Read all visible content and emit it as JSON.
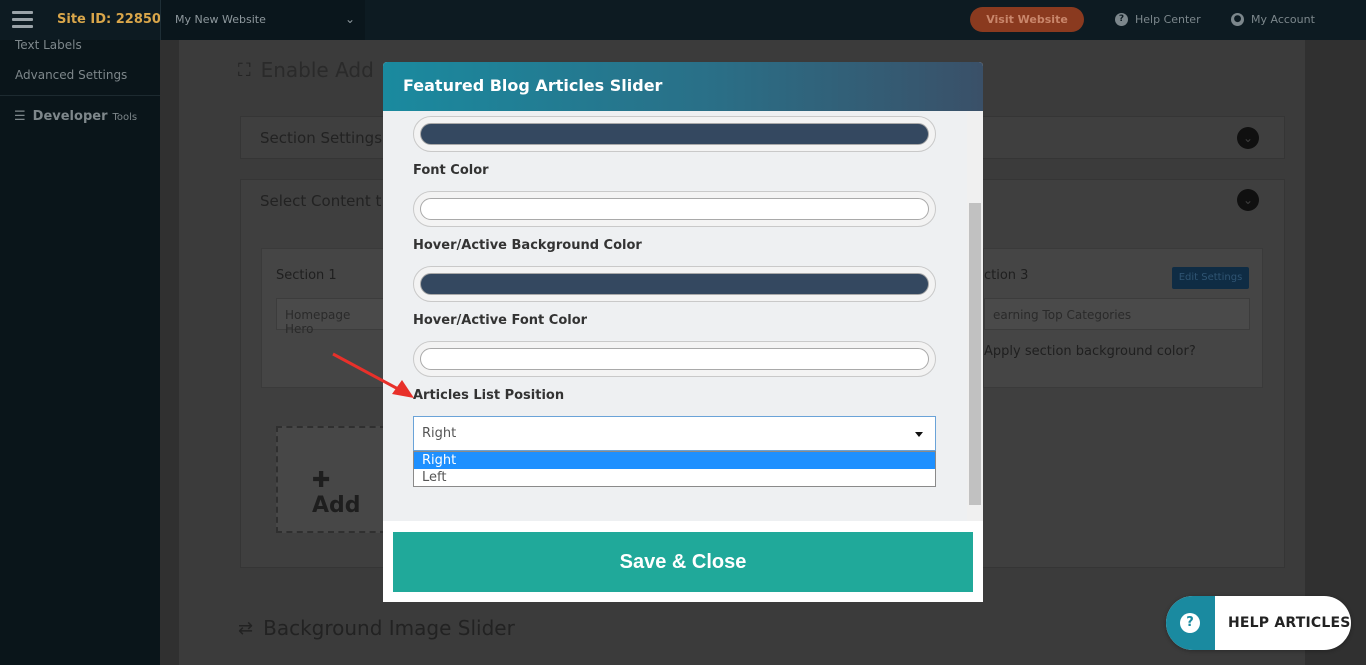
{
  "topbar": {
    "site_id": "Site ID: 22850",
    "site_select_value": "My New Website",
    "visit_button": "Visit Website",
    "help_center": "Help Center",
    "my_account": "My Account"
  },
  "sidebar": {
    "items": [
      {
        "label": "Text Labels"
      },
      {
        "label": "Advanced Settings"
      }
    ],
    "developer_tools": "Developer",
    "developer_tools_small": "Tools"
  },
  "background": {
    "heading1": "Enable Add",
    "panel1_title": "Section Settings",
    "panel2_title": "Select Content t",
    "section1_label": "Section 1",
    "section1_value": "Homepage Hero",
    "section3_label": "ction 3",
    "edit_settings": "Edit Settings",
    "section3_value": "earning Top Categories",
    "apply_bg": "Apply section background color?",
    "add_label": "Add",
    "heading2": "Background Image Slider"
  },
  "modal": {
    "title": "Featured Blog Articles Slider",
    "fields": [
      {
        "label": "Font Color"
      },
      {
        "label": "Hover/Active Background Color"
      },
      {
        "label": "Hover/Active Font Color"
      }
    ],
    "colors": {
      "top_swatch": "#344860",
      "font_color": "#ffffff",
      "hover_bg": "#344860",
      "hover_font": "#ffffff"
    },
    "position_label": "Articles List Position",
    "position_value": "Right",
    "options": [
      "Right",
      "Left"
    ],
    "save_button": "Save & Close"
  },
  "help": {
    "label": "HELP ARTICLES"
  }
}
